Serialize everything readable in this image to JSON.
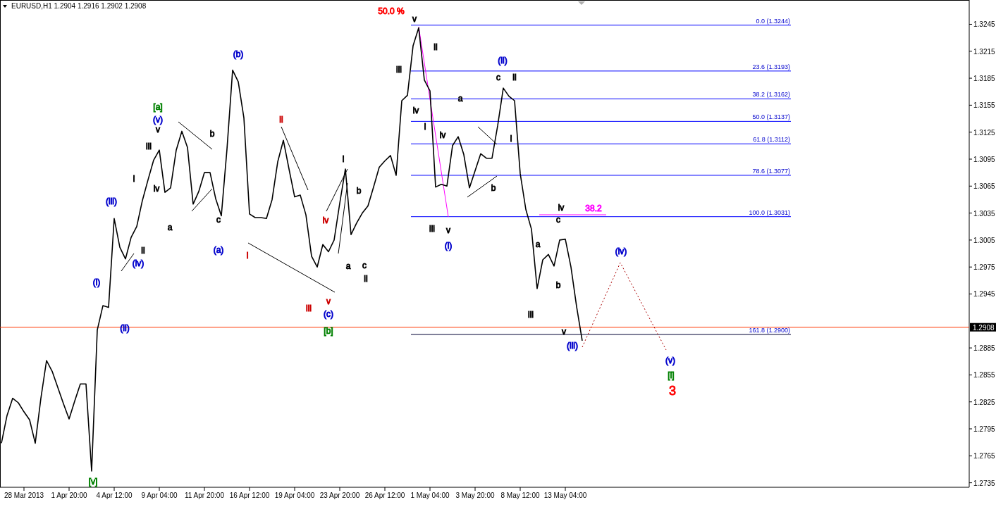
{
  "chart": {
    "chart_data": {
      "type": "line",
      "title": "EURUSD,H1  1.2904 1.2916 1.2902 1.2908",
      "ylim": [
        1.273,
        1.3272
      ],
      "categories": [
        null,
        null,
        null,
        null,
        "28 Mar 2013",
        null,
        null,
        null,
        null,
        null,
        null,
        null,
        "1 Apr 20:00",
        null,
        null,
        null,
        null,
        null,
        null,
        null,
        "4 Apr 12:00",
        null,
        null,
        null,
        null,
        null,
        null,
        null,
        "9 Apr 04:00",
        null,
        null,
        null,
        null,
        null,
        null,
        null,
        "11 Apr 20:00",
        null,
        null,
        null,
        null,
        null,
        null,
        null,
        "16 Apr 12:00",
        null,
        null,
        null,
        null,
        null,
        null,
        null,
        "19 Apr 04:00",
        null,
        null,
        null,
        null,
        null,
        null,
        null,
        "23 Apr 20:00",
        null,
        null,
        null,
        null,
        null,
        null,
        null,
        "26 Apr 12:00",
        null,
        null,
        null,
        null,
        null,
        null,
        null,
        "1 May 04:00",
        null,
        null,
        null,
        null,
        null,
        null,
        null,
        "3 May 20:00",
        null,
        null,
        null,
        null,
        null,
        null,
        null,
        "8 May 12:00",
        null,
        null,
        null,
        null,
        null,
        null,
        null,
        "13 May 04:00",
        null,
        null,
        null
      ],
      "yticks": [
        {
          "value": 1.3245,
          "label": "1.3245"
        },
        {
          "value": 1.3215,
          "label": "1.3215"
        },
        {
          "value": 1.3185,
          "label": "1.3185"
        },
        {
          "value": 1.3155,
          "label": "1.3155"
        },
        {
          "value": 1.3125,
          "label": "1.3125"
        },
        {
          "value": 1.3095,
          "label": "1.3095"
        },
        {
          "value": 1.3065,
          "label": "1.3065"
        },
        {
          "value": 1.3035,
          "label": "1.3035"
        },
        {
          "value": 1.3005,
          "label": "1.3005"
        },
        {
          "value": 1.2975,
          "label": "1.2975"
        },
        {
          "value": 1.2945,
          "label": "1.2945"
        },
        {
          "value": 1.2885,
          "label": "1.2885"
        },
        {
          "value": 1.2855,
          "label": "1.2855"
        },
        {
          "value": 1.2825,
          "label": "1.2825"
        },
        {
          "value": 1.2795,
          "label": "1.2795"
        },
        {
          "value": 1.2765,
          "label": "1.2765"
        },
        {
          "value": 1.2735,
          "label": "1.2735"
        }
      ],
      "series": [
        {
          "color": "#000000",
          "values": [
            1.2779,
            1.281,
            1.2829,
            1.2824,
            1.2814,
            1.2805,
            1.2779,
            1.2829,
            1.2871,
            1.2859,
            1.2841,
            1.2823,
            1.2806,
            1.2826,
            1.2845,
            1.2845,
            1.2748,
            1.2905,
            1.2932,
            1.293,
            1.3029,
            1.2997,
            1.2984,
            1.3008,
            1.302,
            1.3049,
            1.3072,
            1.3094,
            1.3105,
            1.3058,
            1.3063,
            1.3105,
            1.3126,
            1.3108,
            1.3045,
            1.3059,
            1.308,
            1.308,
            1.3051,
            1.3032,
            1.3106,
            1.3194,
            1.3181,
            1.3141,
            1.3034,
            1.303,
            1.303,
            1.3029,
            1.305,
            1.3092,
            1.3116,
            1.3084,
            1.3053,
            1.3055,
            1.3033,
            1.2987,
            1.2975,
            1.3,
            1.2992,
            1.3005,
            1.3046,
            1.3084,
            1.3011,
            1.3024,
            1.3035,
            1.3043,
            1.3064,
            1.3086,
            1.3093,
            1.3099,
            1.3077,
            1.316,
            1.3166,
            1.3221,
            1.3241,
            1.3183,
            1.3171,
            1.3064,
            1.3067,
            1.3065,
            1.311,
            1.312,
            1.31,
            1.3063,
            1.3082,
            1.3101,
            1.3096,
            1.3096,
            1.3132,
            1.3174,
            1.3165,
            1.316,
            1.3079,
            1.3039,
            1.3017,
            1.2951,
            1.2983,
            1.2989,
            1.2976,
            1.3005,
            1.3006,
            1.2975,
            1.2931,
            1.2893
          ]
        }
      ],
      "ref_lines": [
        {
          "axis": "y",
          "value": 1.3244,
          "label": "0.0 (1.3244)",
          "color": "#0000ff"
        },
        {
          "axis": "y",
          "value": 1.3193,
          "label": "23.6 (1.3193)",
          "color": "#0000ff"
        },
        {
          "axis": "y",
          "value": 1.3162,
          "label": "38.2 (1.3162)",
          "color": "#0000ff"
        },
        {
          "axis": "y",
          "value": 1.3137,
          "label": "50.0 (1.3137)",
          "color": "#0000ff"
        },
        {
          "axis": "y",
          "value": 1.3112,
          "label": "61.8 (1.3112)",
          "color": "#0000ff"
        },
        {
          "axis": "y",
          "value": 1.3077,
          "label": "78.6 (1.3077)",
          "color": "#0000ff"
        },
        {
          "axis": "y",
          "value": 1.3031,
          "label": "100.0 (1.3031)",
          "color": "#0000ff"
        },
        {
          "axis": "y",
          "value": 1.29,
          "label": "161.8 (1.2900)",
          "color": "#000033"
        },
        {
          "axis": "y",
          "value": 1.2908,
          "label": "1.2908",
          "color": "#ff3300"
        }
      ]
    },
    "wave_labels": [
      {
        "text": "(i)",
        "color": "#0000cc",
        "kind": "label"
      },
      {
        "text": "[v]",
        "color": "#008000",
        "kind": "label"
      },
      {
        "text": "(iii)",
        "color": "#0000cc",
        "kind": "label"
      },
      {
        "text": "(ii)",
        "color": "#0000cc",
        "kind": "label"
      },
      {
        "text": "i",
        "color": "#000000",
        "kind": "label"
      },
      {
        "text": "ii",
        "color": "#000000",
        "kind": "label"
      },
      {
        "text": "(iv)",
        "color": "#0000cc",
        "kind": "label"
      },
      {
        "text": "iii",
        "color": "#000000",
        "kind": "label"
      },
      {
        "text": "[a]",
        "color": "#008000",
        "kind": "label"
      },
      {
        "text": "(v)",
        "color": "#0000cc",
        "kind": "label"
      },
      {
        "text": "v",
        "color": "#000000",
        "kind": "label"
      },
      {
        "text": "iv",
        "color": "#000000",
        "kind": "label"
      },
      {
        "text": "a",
        "color": "#000000",
        "kind": "label"
      },
      {
        "text": "b",
        "color": "#000000",
        "kind": "label"
      },
      {
        "text": "c",
        "color": "#000000",
        "kind": "label"
      },
      {
        "text": "(a)",
        "color": "#0000cc",
        "kind": "label"
      },
      {
        "text": "(b)",
        "color": "#0000cc",
        "kind": "label"
      },
      {
        "text": "i",
        "color": "#cc0000",
        "kind": "label"
      },
      {
        "text": "ii",
        "color": "#cc0000",
        "kind": "label"
      },
      {
        "text": "iii",
        "color": "#cc0000",
        "kind": "label"
      },
      {
        "text": "iv",
        "color": "#cc0000",
        "kind": "label"
      },
      {
        "text": "v",
        "color": "#cc0000",
        "kind": "label"
      },
      {
        "text": "(c)",
        "color": "#0000cc",
        "kind": "label"
      },
      {
        "text": "[b]",
        "color": "#008000",
        "kind": "label"
      },
      {
        "text": "i",
        "color": "#000000",
        "kind": "label"
      },
      {
        "text": "a",
        "color": "#000000",
        "kind": "label"
      },
      {
        "text": "b",
        "color": "#000000",
        "kind": "label"
      },
      {
        "text": "c",
        "color": "#000000",
        "kind": "label"
      },
      {
        "text": "ii",
        "color": "#000000",
        "kind": "label"
      },
      {
        "text": "50.0 %",
        "color": "#ff0000",
        "kind": "label"
      },
      {
        "text": "iii",
        "color": "#000000",
        "kind": "label"
      },
      {
        "text": "v",
        "color": "#000000",
        "kind": "label"
      },
      {
        "text": "iv",
        "color": "#000000",
        "kind": "label"
      },
      {
        "text": "i",
        "color": "#000000",
        "kind": "label"
      },
      {
        "text": "ii",
        "color": "#000000",
        "kind": "label"
      },
      {
        "text": "iii",
        "color": "#000000",
        "kind": "label"
      },
      {
        "text": "iv",
        "color": "#000000",
        "kind": "label"
      },
      {
        "text": "v",
        "color": "#000000",
        "kind": "label"
      },
      {
        "text": "(i)",
        "color": "#0000cc",
        "kind": "label"
      },
      {
        "text": "a",
        "color": "#000000",
        "kind": "label"
      },
      {
        "text": "b",
        "color": "#000000",
        "kind": "label"
      },
      {
        "text": "(ii)",
        "color": "#0000cc",
        "kind": "label"
      },
      {
        "text": "c",
        "color": "#000000",
        "kind": "label"
      },
      {
        "text": "i",
        "color": "#000000",
        "kind": "label"
      },
      {
        "text": "ii",
        "color": "#000000",
        "kind": "label"
      },
      {
        "text": "iii",
        "color": "#000000",
        "kind": "label"
      },
      {
        "text": "a",
        "color": "#000000",
        "kind": "label"
      },
      {
        "text": "iv",
        "color": "#000000",
        "kind": "label"
      },
      {
        "text": "c",
        "color": "#000000",
        "kind": "label"
      },
      {
        "text": "b",
        "color": "#000000",
        "kind": "label"
      },
      {
        "text": "v",
        "color": "#000000",
        "kind": "label"
      },
      {
        "text": "(iii)",
        "color": "#0000cc",
        "kind": "label"
      },
      {
        "text": "38.2",
        "color": "#ff00ff",
        "kind": "label"
      },
      {
        "text": "(iv)",
        "color": "#0000cc",
        "kind": "label"
      },
      {
        "text": "(v)",
        "color": "#0000cc",
        "kind": "label"
      },
      {
        "text": "[i]",
        "color": "#008000",
        "kind": "label"
      },
      {
        "text": "3",
        "color": "#ff0000",
        "kind": "large"
      }
    ]
  }
}
